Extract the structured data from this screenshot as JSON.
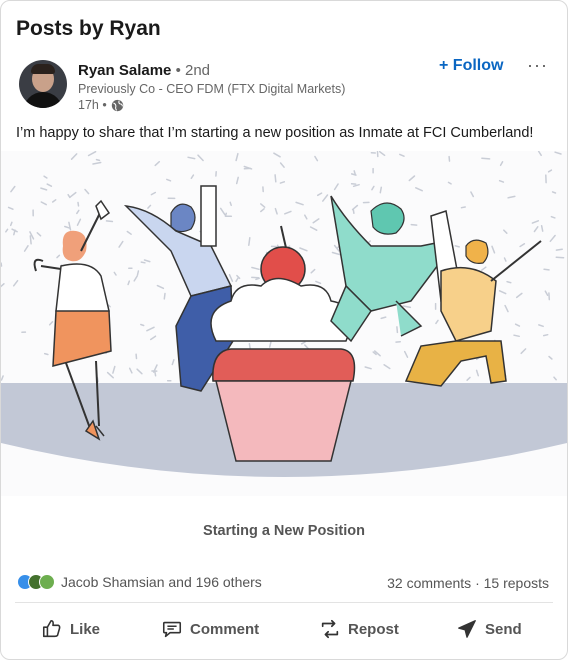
{
  "page": {
    "title": "Posts by Ryan"
  },
  "post": {
    "author": {
      "name": "Ryan Salame",
      "degree": "• 2nd",
      "headline": "Previously Co - CEO FDM (FTX Digital Markets)",
      "time": "17h •"
    },
    "follow_label": "+ Follow",
    "more_label": "···",
    "text": "I’m happy to share that I’m starting a new position as Inmate at FCI Cumberland!",
    "image_caption": "Starting a New Position",
    "reactions_text": "Jacob Shamsian and 196 others",
    "counts_text": "32 comments · 15 reposts"
  },
  "actions": [
    {
      "label": "Like",
      "icon": "thumbs-up-icon"
    },
    {
      "label": "Comment",
      "icon": "comment-icon"
    },
    {
      "label": "Repost",
      "icon": "repost-icon"
    },
    {
      "label": "Send",
      "icon": "send-icon"
    }
  ],
  "colors": {
    "accent": "#0a66c2",
    "text_muted": "#666666"
  }
}
